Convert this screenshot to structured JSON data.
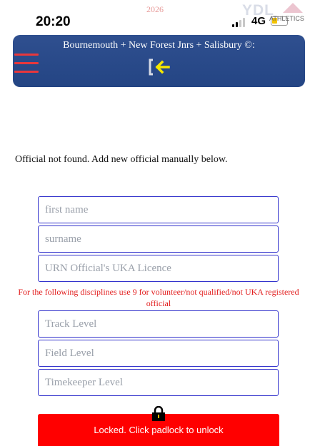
{
  "status_bar": {
    "time": "20:20",
    "year": "2026",
    "network": "4G"
  },
  "logo": {
    "main_text": "YDL",
    "sub_text": "ATHLETICS"
  },
  "header": {
    "title": "Bournemouth + New Forest Jnrs + Salisbury ©:"
  },
  "icons": {
    "menu": "hamburger-menu-icon",
    "back": "exit-arrow-icon",
    "padlock": "padlock-icon"
  },
  "message": "Official not found. Add new official manually below.",
  "form": {
    "first_name_placeholder": "first name",
    "surname_placeholder": "surname",
    "urn_placeholder": "URN Official's UKA Licence",
    "note": "For the following disciplines use 9 for volunteer/not qualified/not UKA registered official",
    "track_placeholder": "Track Level",
    "field_placeholder": "Field Level",
    "timekeeper_placeholder": "Timekeeper Level"
  },
  "locked_button": {
    "label": "Locked. Click padlock to unlock"
  },
  "colors": {
    "header_bg": "#2a4a8a",
    "menu_red": "#e8373c",
    "field_border": "#3333cc",
    "note_red": "#e21d1d",
    "locked_red": "#ff0000",
    "arrow_yellow": "#f5e600"
  }
}
